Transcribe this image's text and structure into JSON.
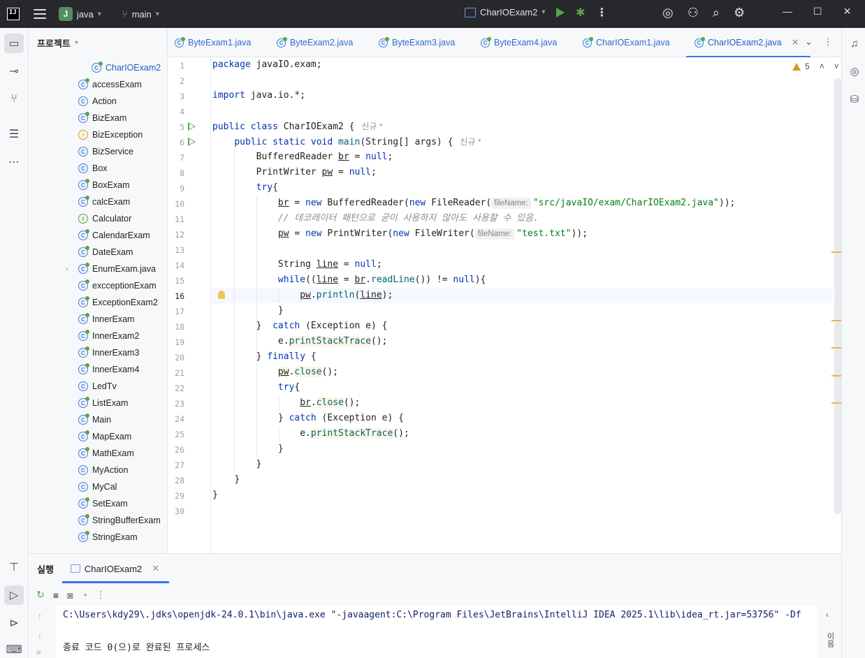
{
  "titlebar": {
    "logo_text": "IJ",
    "project_badge": "J",
    "project_name": "java",
    "branch": "main",
    "run_config": "CharIOExam2"
  },
  "project_panel": {
    "title": "프로젝트",
    "items": [
      {
        "label": "CharIOExam2",
        "icon": "class-run-icon",
        "kind": "class"
      },
      {
        "label": "accessExam",
        "icon": "class-run-icon",
        "kind": "class"
      },
      {
        "label": "Action",
        "icon": "class-icon",
        "kind": "class"
      },
      {
        "label": "BizExam",
        "icon": "class-run-icon",
        "kind": "class"
      },
      {
        "label": "BizException",
        "icon": "exception-icon",
        "kind": "exc"
      },
      {
        "label": "BizService",
        "icon": "class-icon",
        "kind": "class"
      },
      {
        "label": "Box",
        "icon": "class-icon",
        "kind": "class"
      },
      {
        "label": "BoxExam",
        "icon": "class-run-icon",
        "kind": "class"
      },
      {
        "label": "calcExam",
        "icon": "class-run-icon",
        "kind": "class"
      },
      {
        "label": "Calculator",
        "icon": "interface-icon",
        "kind": "itf"
      },
      {
        "label": "CalendarExam",
        "icon": "class-run-icon",
        "kind": "class"
      },
      {
        "label": "DateExam",
        "icon": "class-run-icon",
        "kind": "class"
      },
      {
        "label": "EnumExam.java",
        "icon": "class-run-icon",
        "kind": "class"
      },
      {
        "label": "excceptionExam",
        "icon": "class-run-icon",
        "kind": "class"
      },
      {
        "label": "ExceptionExam2",
        "icon": "class-run-icon",
        "kind": "class"
      },
      {
        "label": "InnerExam",
        "icon": "class-run-icon",
        "kind": "class"
      },
      {
        "label": "InnerExam2",
        "icon": "class-run-icon",
        "kind": "class"
      },
      {
        "label": "InnerExam3",
        "icon": "class-run-icon",
        "kind": "class"
      },
      {
        "label": "InnerExam4",
        "icon": "class-run-icon",
        "kind": "class"
      },
      {
        "label": "LedTv",
        "icon": "class-icon",
        "kind": "class"
      },
      {
        "label": "ListExam",
        "icon": "class-run-icon",
        "kind": "class"
      },
      {
        "label": "Main",
        "icon": "class-run-icon",
        "kind": "class"
      },
      {
        "label": "MapExam",
        "icon": "class-run-icon",
        "kind": "class"
      },
      {
        "label": "MathExam",
        "icon": "class-run-icon",
        "kind": "class"
      },
      {
        "label": "MyAction",
        "icon": "class-icon",
        "kind": "class"
      },
      {
        "label": "MyCal",
        "icon": "class-icon",
        "kind": "class"
      },
      {
        "label": "SetExam",
        "icon": "class-run-icon",
        "kind": "class"
      },
      {
        "label": "StringBufferExam",
        "icon": "class-run-icon",
        "kind": "class"
      },
      {
        "label": "StringExam",
        "icon": "class-run-icon",
        "kind": "class"
      }
    ]
  },
  "tabs": [
    {
      "label": "ByteExam1.java"
    },
    {
      "label": "ByteExam2.java"
    },
    {
      "label": "ByteExam3.java"
    },
    {
      "label": "ByteExam4.java"
    },
    {
      "label": "CharIOExam1.java"
    },
    {
      "label": "CharIOExam2.java",
      "active": true
    }
  ],
  "editor": {
    "warning_count": "5",
    "current_line": 16,
    "author_hint": "신규 *",
    "hint_filename": "fileName:",
    "line_numbers": [
      "1",
      "2",
      "3",
      "4",
      "5",
      "6",
      "7",
      "8",
      "9",
      "10",
      "11",
      "12",
      "13",
      "14",
      "15",
      "16",
      "17",
      "18",
      "19",
      "20",
      "21",
      "22",
      "23",
      "24",
      "25",
      "26",
      "27",
      "28",
      "29",
      "30"
    ],
    "code": {
      "l1_kw": "package",
      "l1_rest": " javaIO.exam;",
      "l3_kw": "import",
      "l3_rest": " java.io.*;",
      "l5_kw": "public class",
      "l5_rest": " CharIOExam2 {",
      "l6_kw": "public static void",
      "l6_mth": "main",
      "l6_rest": "(String[] args) {",
      "l7_a": "BufferedReader ",
      "l7_var": "br",
      "l7_b": " = ",
      "l7_null": "null",
      "l7_c": ";",
      "l8_a": "PrintWriter ",
      "l8_var": "pw",
      "l8_b": " = ",
      "l8_null": "null",
      "l8_c": ";",
      "l9_kw": "try",
      "l9_rest": "{",
      "l10_var": "br",
      "l10_a": " = ",
      "l10_new1": "new",
      "l10_b": " BufferedReader(",
      "l10_new2": "new",
      "l10_c": " FileReader(",
      "l10_str": "\"src/javaIO/exam/CharIOExam2.java\"",
      "l10_d": "));",
      "l11_comment": "// 데코레이터 패턴으로 굳이 사용하지 않아도 사용할 수 있음.",
      "l12_var": "pw",
      "l12_a": " = ",
      "l12_new1": "new",
      "l12_b": " PrintWriter(",
      "l12_new2": "new",
      "l12_c": " FileWriter(",
      "l12_str": "\"test.txt\"",
      "l12_d": "));",
      "l14_a": "String ",
      "l14_var": "line",
      "l14_b": " = ",
      "l14_null": "null",
      "l14_c": ";",
      "l15_kw": "while",
      "l15_a": "((",
      "l15_var1": "line",
      "l15_b": " = ",
      "l15_var2": "br",
      "l15_c": ".",
      "l15_mth": "readLine",
      "l15_d": "()) != ",
      "l15_null": "null",
      "l15_e": "){",
      "l16_var": "pw",
      "l16_a": ".",
      "l16_mth": "println",
      "l16_b": "(",
      "l16_var2": "line",
      "l16_c": ");",
      "l17": "}",
      "l18_a": "}  ",
      "l18_kw": "catch",
      "l18_b": " (Exception e) {",
      "l19_a": "e.",
      "l19_mth": "printStackTrace",
      "l19_b": "();",
      "l20_a": "} ",
      "l20_kw": "finally",
      "l20_b": " {",
      "l21_var": "pw",
      "l21_a": ".",
      "l21_mth": "close",
      "l21_b": "();",
      "l22_kw": "try",
      "l22_b": "{",
      "l23_var": "br",
      "l23_a": ".",
      "l23_mth": "close",
      "l23_b": "();",
      "l24_a": "} ",
      "l24_kw": "catch",
      "l24_b": " (Exception e) {",
      "l25_a": "e.",
      "l25_mth": "printStackTrace",
      "l25_b": "();",
      "l26": "}",
      "l27": "}",
      "l28": "}",
      "l29": "}"
    }
  },
  "run_panel": {
    "title": "실행",
    "tab_label": "CharIOExam2",
    "console_line1": "C:\\Users\\kdy29\\.jdks\\openjdk-24.0.1\\bin\\java.exe \"-javaagent:C:\\Program Files\\JetBrains\\IntelliJ IDEA 2025.1\\lib\\idea_rt.jar=53756\" -Df",
    "console_line2": "종료 코드 0(으)로 완료된 프로세스",
    "side_label": "이음"
  },
  "colors": {
    "titlebar_bg": "#27282c",
    "accent": "#3574f0",
    "run_green": "#57a64a",
    "keyword": "#0033b3",
    "string": "#067d17"
  }
}
